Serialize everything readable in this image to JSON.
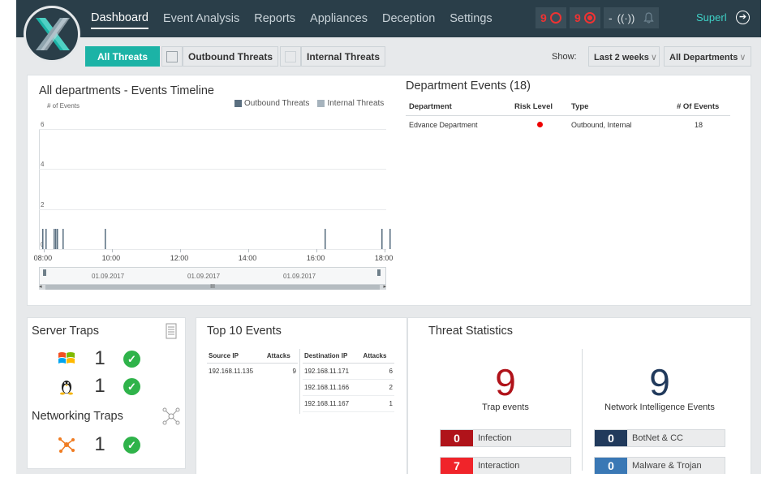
{
  "nav": {
    "items": [
      {
        "label": "Dashboard",
        "active": true
      },
      {
        "label": "Event Analysis",
        "active": false
      },
      {
        "label": "Reports",
        "active": false
      },
      {
        "label": "Appliances",
        "active": false
      },
      {
        "label": "Deception",
        "active": false
      },
      {
        "label": "Settings",
        "active": false
      }
    ],
    "alert_ring_count": "9",
    "alert_target_count": "9",
    "signal_count": "-",
    "user": "Superl"
  },
  "filters": {
    "all": "All Threats",
    "outbound": "Outbound Threats",
    "internal": "Internal Threats",
    "show_label": "Show:",
    "period": "Last 2 weeks",
    "departments": "All Departments"
  },
  "timeline": {
    "title": "All departments - Events Timeline",
    "y_label": "# of Events",
    "legend": [
      {
        "name": "Outbound Threats",
        "color": "#5b6f80"
      },
      {
        "name": "Internal Threats",
        "color": "#a6b3bd"
      }
    ],
    "y_ticks": [
      "6",
      "4",
      "2",
      "0"
    ],
    "x_ticks": [
      "08:00",
      "10:00",
      "12:00",
      "14:00",
      "16:00",
      "18:00"
    ],
    "nav_dates": [
      "01.09.2017",
      "01.09.2017",
      "01.09.2017"
    ],
    "scroll_thumb": "III"
  },
  "chart_data": {
    "type": "bar",
    "xlabel": "",
    "ylabel": "# of Events",
    "ylim": [
      0,
      6
    ],
    "x_ticks": [
      "08:00",
      "10:00",
      "12:00",
      "14:00",
      "16:00",
      "18:00"
    ],
    "series": [
      {
        "name": "Outbound Threats",
        "color": "#5b6f80",
        "points": [
          [
            "07:58",
            1
          ],
          [
            "08:03",
            1
          ],
          [
            "08:18",
            1
          ],
          [
            "08:20",
            1
          ],
          [
            "08:23",
            1
          ],
          [
            "08:33",
            1
          ],
          [
            "09:48",
            1
          ],
          [
            "16:15",
            1
          ],
          [
            "17:55",
            1
          ],
          [
            "18:08",
            1
          ]
        ]
      },
      {
        "name": "Internal Threats",
        "color": "#a6b3bd",
        "points": [
          [
            "07:58",
            1
          ],
          [
            "08:03",
            1
          ],
          [
            "08:18",
            1
          ],
          [
            "08:20",
            1
          ],
          [
            "08:23",
            1
          ],
          [
            "08:33",
            1
          ],
          [
            "09:48",
            1
          ],
          [
            "16:15",
            1
          ],
          [
            "17:55",
            1
          ],
          [
            "18:08",
            1
          ]
        ]
      }
    ]
  },
  "dept_events": {
    "title": "Department Events (18)",
    "headers": [
      "Department",
      "Risk Level",
      "Type",
      "# Of Events"
    ],
    "rows": [
      {
        "department": "Edvance Department",
        "risk": "high",
        "type": "Outbound, Internal",
        "events": "18"
      }
    ]
  },
  "server_traps": {
    "title": "Server Traps",
    "rows": [
      {
        "icon": "windows-icon",
        "count": "1",
        "status": "ok"
      },
      {
        "icon": "linux-icon",
        "count": "1",
        "status": "ok"
      }
    ]
  },
  "networking_traps": {
    "title": "Networking Traps",
    "rows": [
      {
        "icon": "network-node-icon",
        "count": "1",
        "status": "ok"
      }
    ]
  },
  "top10": {
    "title": "Top 10 Events",
    "source_headers": [
      "Source IP",
      "Attacks"
    ],
    "source_rows": [
      {
        "ip": "192.168.11.135",
        "attacks": "9"
      }
    ],
    "dest_headers": [
      "Destination IP",
      "Attacks"
    ],
    "dest_rows": [
      {
        "ip": "192.168.11.171",
        "attacks": "6"
      },
      {
        "ip": "192.168.11.166",
        "attacks": "2"
      },
      {
        "ip": "192.168.11.167",
        "attacks": "1"
      }
    ]
  },
  "threat_stats": {
    "title": "Threat Statistics",
    "trap_total": "9",
    "trap_label": "Trap events",
    "trap_color": "#b0131a",
    "net_total": "9",
    "net_label": "Network Intelligence Events",
    "net_color": "#213a5c",
    "trap_rows": [
      {
        "count": "0",
        "name": "Infection",
        "color": "#b0131a"
      },
      {
        "count": "7",
        "name": "Interaction",
        "color": "#f0242a"
      }
    ],
    "net_rows": [
      {
        "count": "0",
        "name": "BotNet & CC",
        "color": "#213a5c"
      },
      {
        "count": "0",
        "name": "Malware & Trojan",
        "color": "#3a78b5"
      }
    ]
  }
}
